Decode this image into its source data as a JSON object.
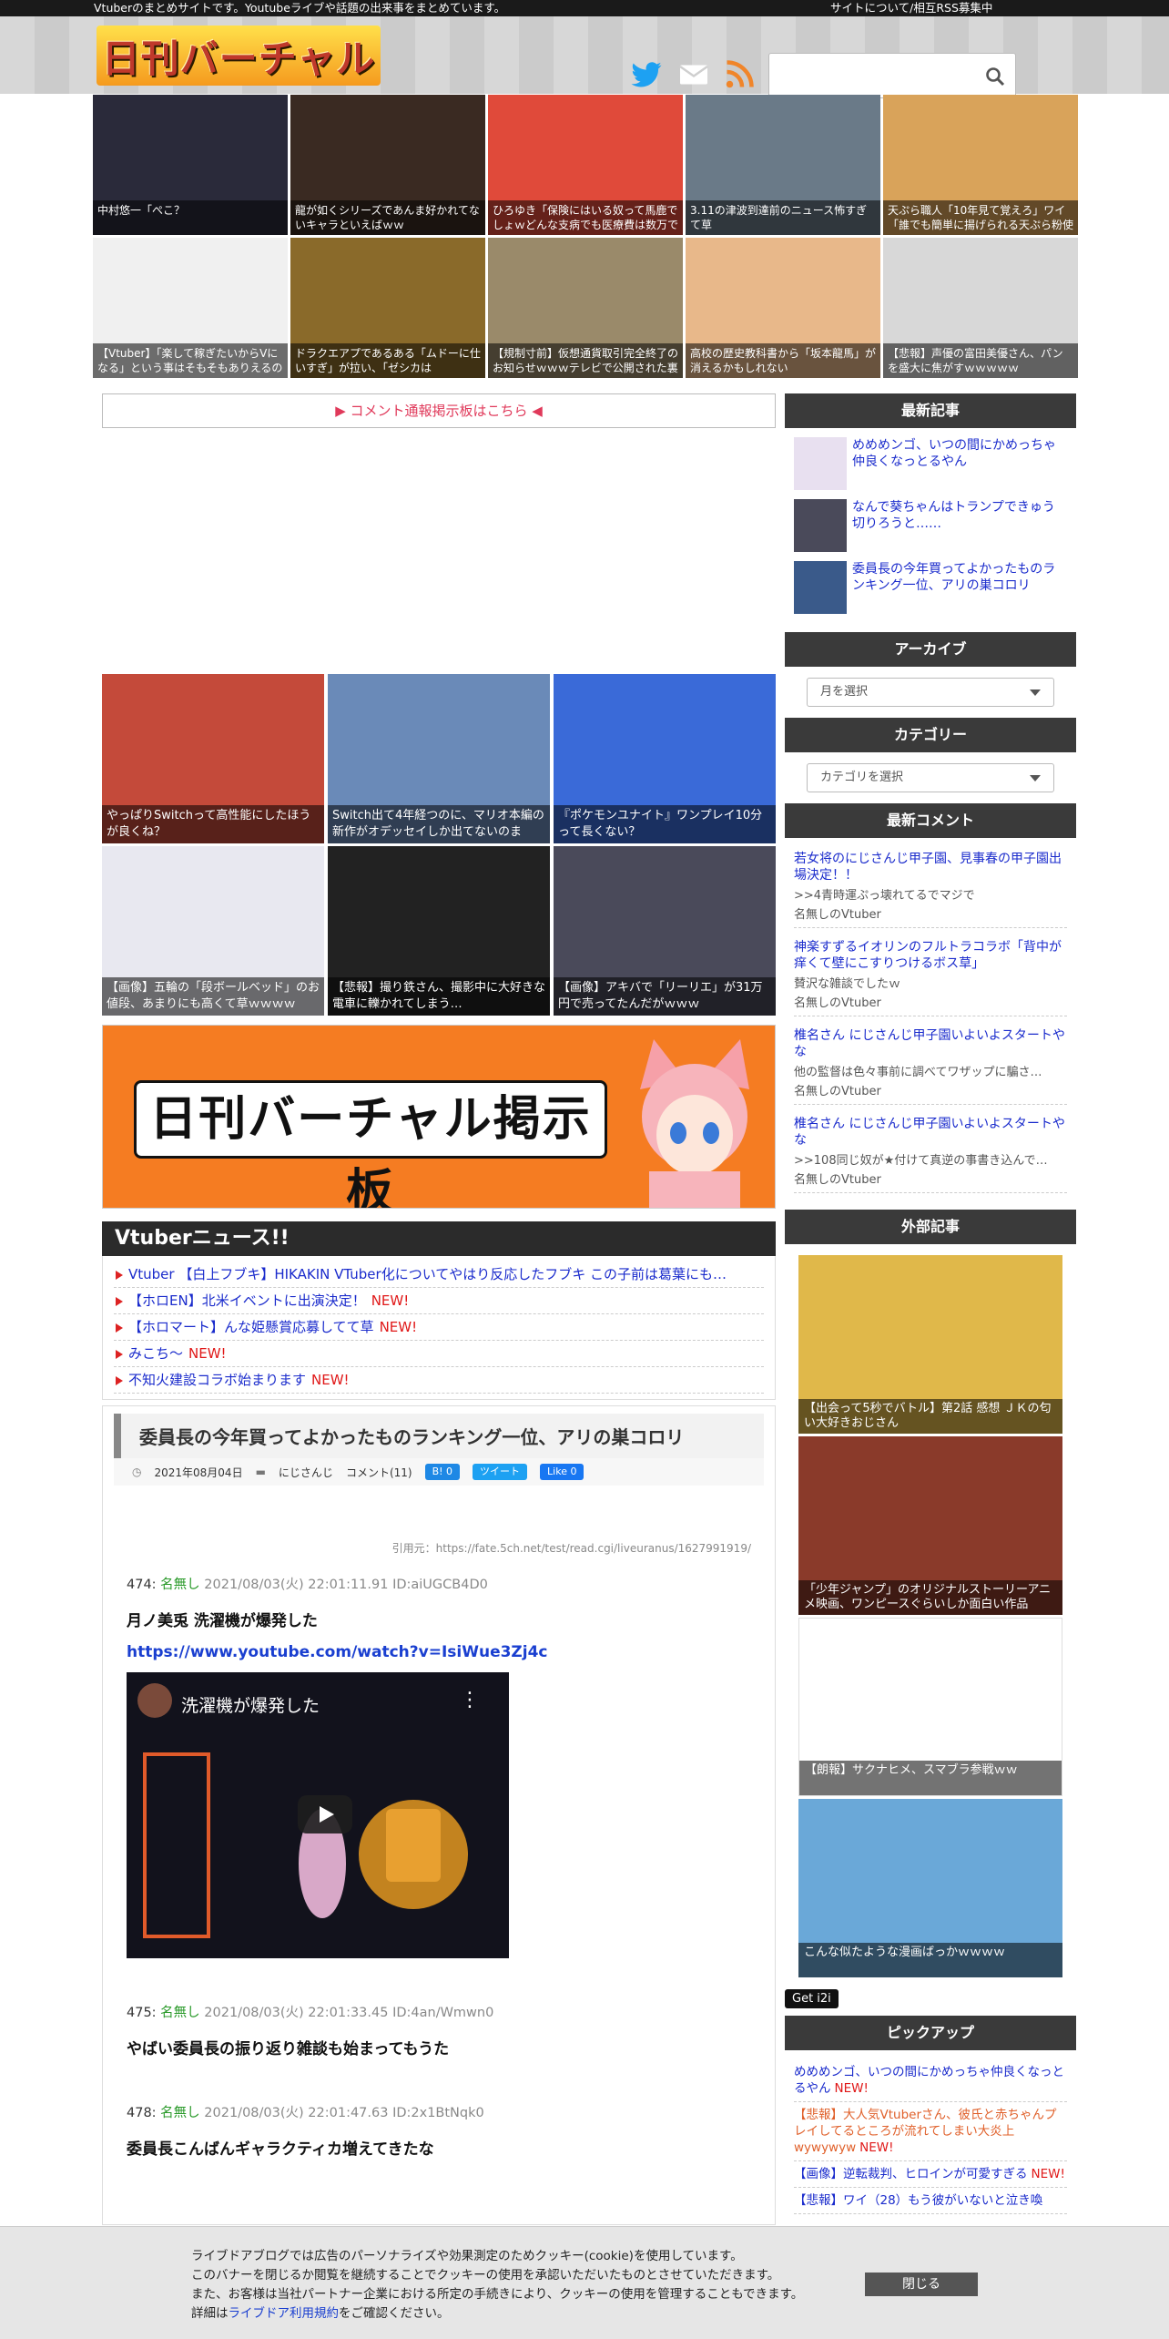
{
  "topbar": {
    "tagline": "Vtuberのまとめサイトです。Youtubeライブや話題の出来事をまとめています。",
    "right_links": "サイトについて/相互RSS募集中"
  },
  "header": {
    "logo_text": "日刊バーチャル",
    "search_placeholder": ""
  },
  "top_tiles": [
    {
      "caption": "中村悠一「ぺこ？",
      "color": "#2a2a3a"
    },
    {
      "caption": "龍が如くシリーズであんま好かれてないキャラといえばｗｗ",
      "color": "#3a2a22"
    },
    {
      "caption": "ひろゆき「保険にはいる奴って馬鹿でしょｗどんな支病でも医療費は数万で",
      "color": "#e04a3a"
    },
    {
      "caption": "3.11の津波到達前のニュース怖すぎて草",
      "color": "#6a7a88"
    },
    {
      "caption": "天ぷら職人「10年見て覚えろ」ワイ「誰でも簡単に揚げられる天ぷら粉使",
      "color": "#d9a35a"
    },
    {
      "caption": "【Vtuber】「楽して稼ぎたいからVになる」という事はそもそもありえるの",
      "color": "#f0f0f0"
    },
    {
      "caption": "ドラクエアプであるある「ムドーに仕いすぎ」が拉い、「ゼシカは",
      "color": "#8a6a2a"
    },
    {
      "caption": "【規制寸前】仮想通貨取引完全終了のお知らせｗｗｗテレビで公開された裏",
      "color": "#9a8a6a"
    },
    {
      "caption": "高校の歴史教科書から「坂本龍馬」が消えるかもしれない",
      "color": "#e8b88a"
    },
    {
      "caption": "【悲報】声優の富田美優さん、パンを盛大に焦がすｗｗｗｗｗ",
      "color": "#d8d8d8"
    }
  ],
  "comment_banner": "▶ コメント通報掲示板はこちら ◀",
  "mid_tiles": [
    {
      "caption": "やっぱりSwitchって高性能にしたほうが良くね？",
      "color": "#c44a3a"
    },
    {
      "caption": "Switch出て4年経つのに、マリオ本編の新作がオデッセイしか出てないのま",
      "color": "#6a8ab8"
    },
    {
      "caption": "『ポケモンユナイト』ワンプレイ10分って長くない？",
      "color": "#3a6ad8"
    },
    {
      "caption": "【画像】五輪の「段ボールベッド」のお値段、あまりにも高くて草ｗｗｗｗ",
      "color": "#e8e8f0"
    },
    {
      "caption": "【悲報】撮り鉄さん、撮影中に大好きな電車に轢かれてしまう…",
      "color": "#222222"
    },
    {
      "caption": "【画像】アキバで「リーリエ」が31万円で売ってたんだがｗｗｗ",
      "color": "#4a4a5a"
    }
  ],
  "bbs_banner": {
    "text": "日刊バーチャル掲示板"
  },
  "news": {
    "title": "Vtuberニュース!!",
    "items": [
      {
        "text": "Vtuber 【白上フブキ】HIKAKIN VTuber化についてやはり反応したフブキ この子前は葛葉にも…",
        "new": ""
      },
      {
        "text": "【ホロEN】北米イベントに出演決定！",
        "new": "NEW!"
      },
      {
        "text": "【ホロマート】んな姫懸賞応募してて草",
        "new": "NEW!"
      },
      {
        "text": "みこち～",
        "new": "NEW!"
      },
      {
        "text": "不知火建設コラボ始まります",
        "new": "NEW!"
      }
    ]
  },
  "article": {
    "title": "委員長の今年買ってよかったものランキング一位、アリの巣コロリ",
    "date": "2021年08月04日",
    "category": "にじさんじ",
    "comments": "コメント(11)",
    "hatena": "0",
    "tweet": "ツイート",
    "like": "Like 0",
    "source": "引用元：https://fate.5ch.net/test/read.cgi/liveuranus/1627991919/",
    "responses": [
      {
        "num": "474:",
        "name": "名無し",
        "meta": "2021/08/03(火) 22:01:11.91 ID:aiUGCB4D0",
        "body": "月ノ美兎 洗濯機が爆発した",
        "link": "https://www.youtube.com/watch?v=IsiWue3Zj4c",
        "video_title": "洗濯機が爆発した"
      },
      {
        "num": "475:",
        "name": "名無し",
        "meta": "2021/08/03(火) 22:01:33.45 ID:4an/Wmwn0",
        "body": "やばい委員長の振り返り雑談も始まってもうた"
      },
      {
        "num": "478:",
        "name": "名無し",
        "meta": "2021/08/03(火) 22:01:47.63 ID:2x1BtNqk0",
        "body": "委員長こんばんギャラクティカ増えてきたな"
      }
    ]
  },
  "sidebar": {
    "recent_title": "最新記事",
    "recent": [
      {
        "text": "めめめンゴ、いつの間にかめっちゃ仲良くなっとるやん",
        "color": "#e8e0f0"
      },
      {
        "text": "なんで葵ちゃんはトランプできゅう切りろうと……",
        "color": "#4a4a5a"
      },
      {
        "text": "委員長の今年買ってよかったものランキング一位、アリの巣コロリ",
        "color": "#3a5a8a"
      }
    ],
    "archive_title": "アーカイブ",
    "archive_select": "月を選択",
    "category_title": "カテゴリー",
    "category_select": "カテゴリを選択",
    "recent_comments_title": "最新コメント",
    "recent_comments": [
      {
        "title": "若女将のにじさんじ甲子園、見事春の甲子園出場決定！！",
        "body": ">>4青時運ぷっ壊れてるでマジで",
        "author": "名無しのVtuber"
      },
      {
        "title": "神楽すずるイオリンのフルトラコラボ「背中が痒くて壁にこすりつけるボス草」",
        "body": "賛沢な雑談でしたｗ",
        "author": "名無しのVtuber"
      },
      {
        "title": "椎名さん にじさんじ甲子園いよいよスタートやな",
        "body": "他の監督は色々事前に調べてワザップに騙さ…",
        "author": "名無しのVtuber"
      },
      {
        "title": "椎名さん にじさんじ甲子園いよいよスタートやな",
        "body": ">>108同じ奴が★付けて真逆の事書き込んで…",
        "author": "名無しのVtuber"
      }
    ],
    "external_title": "外部記事",
    "external": [
      {
        "caption": "【出会って5秒でバトル】第2話 感想 ＪＫの匂い大好きおじさん",
        "color": "#e0b84a"
      },
      {
        "caption": "「少年ジャンプ」のオリジナルストーリーアニメ映画、ワンピースぐらいしか面白い作品",
        "color": "#8a3a2a"
      },
      {
        "caption": "【朗報】サクナヒメ、スマブラ参戦ｗｗ",
        "color": "#ffffff"
      },
      {
        "caption": "こんな似たような漫画ばっかｗｗｗｗ",
        "color": "#6aa8d8"
      }
    ],
    "i2i": "Get i2i",
    "pickup_title": "ピックアップ",
    "pickup": [
      {
        "text": "めめめンゴ、いつの間にかめっちゃ仲良くなっとるやん",
        "new": "NEW!",
        "color": "#1a2bcc"
      },
      {
        "text": "【悲報】大人気Vtuberさん、彼氏と赤ちゃんプレイしてるところが流れてしまい大炎上wywywyw",
        "new": "NEW!",
        "color": "#e0602a"
      },
      {
        "text": "【画像】逆転裁判、ヒロインが可愛すぎる",
        "new": "NEW!",
        "color": "#1a2bcc"
      },
      {
        "text": "【悲報】ワイ（28）もう彼がいないと泣き喚",
        "new": "",
        "color": "#1a2bcc"
      }
    ]
  },
  "cookie": {
    "line1": "ライブドアブログでは広告のパーソナライズや効果測定のためクッキー(cookie)を使用しています。",
    "line2": "このバナーを閉じるか閲覧を継続することでクッキーの使用を承認いただいたものとさせていただきます。",
    "line3": "また、お客様は当社パートナー企業における所定の手続きにより、クッキーの使用を管理することもできます。",
    "line4_pre": "詳細は",
    "line4_link": "ライブドア利用規約",
    "line4_post": "をご確認ください。",
    "close": "閉じる"
  },
  "colors": {
    "twitter": "#1da1f2",
    "rss": "#f0852a",
    "hatena": "#1e88e5",
    "tweet": "#1da1f2",
    "like": "#1877f2"
  }
}
